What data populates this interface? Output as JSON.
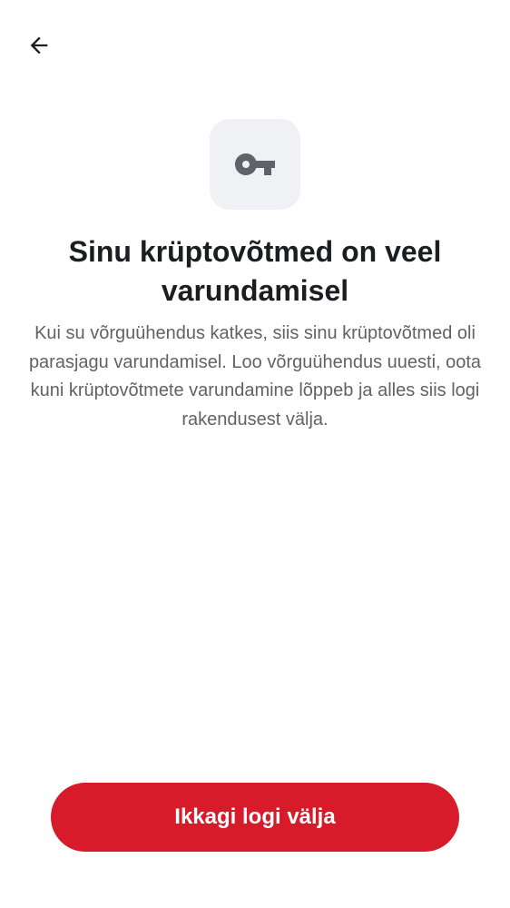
{
  "header": {
    "back_icon": "arrow-left-icon"
  },
  "hero": {
    "icon": "key-icon",
    "title": "Sinu krüptovõtmed on veel varundamisel",
    "description": "Kui su võrguühendus katkes, siis sinu krüptovõtmed oli parasjagu varundamisel. Loo võrguühendus uuesti, oota kuni krüptovõtmete varundamine lõppeb ja alles siis logi rakendusest välja."
  },
  "actions": {
    "logout_label": "Ikkagi logi välja"
  },
  "colors": {
    "primary": "#d81b2a",
    "icon_tile_bg": "#eff1f5",
    "icon": "#5f6368",
    "title": "#1c1d20",
    "body_text": "#5f6368"
  }
}
